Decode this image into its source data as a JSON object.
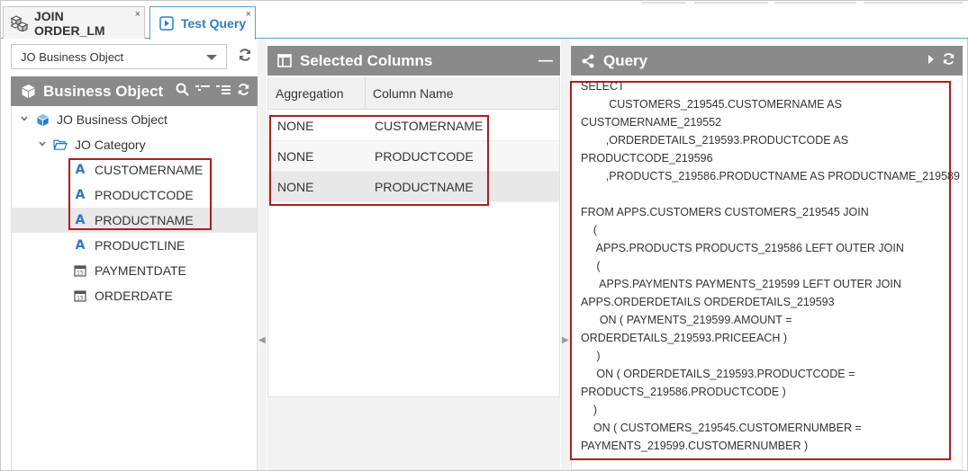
{
  "tabs": [
    {
      "label": "JOIN ORDER_LM",
      "close": "×"
    },
    {
      "label": "Test Query",
      "close": "×"
    }
  ],
  "left": {
    "combo_value": "JO Business Object",
    "panel_title": "Business Object",
    "tree": {
      "root": "JO Business Object",
      "category": "JO Category",
      "items": [
        {
          "label": "CUSTOMERNAME",
          "type": "text"
        },
        {
          "label": "PRODUCTCODE",
          "type": "text"
        },
        {
          "label": "PRODUCTNAME",
          "type": "text"
        },
        {
          "label": "PRODUCTLINE",
          "type": "text"
        },
        {
          "label": "PAYMENTDATE",
          "type": "date"
        },
        {
          "label": "ORDERDATE",
          "type": "date"
        }
      ]
    }
  },
  "middle": {
    "panel_title": "Selected Columns",
    "collapse_symbol": "—",
    "headers": {
      "aggregation": "Aggregation",
      "column_name": "Column Name"
    },
    "rows": [
      {
        "aggregation": "NONE",
        "column": "CUSTOMERNAME"
      },
      {
        "aggregation": "NONE",
        "column": "PRODUCTCODE"
      },
      {
        "aggregation": "NONE",
        "column": "PRODUCTNAME"
      }
    ]
  },
  "right": {
    "panel_title": "Query",
    "lines": [
      "SELECT",
      "         CUSTOMERS_219545.CUSTOMERNAME AS",
      "CUSTOMERNAME_219552",
      "        ,ORDERDETAILS_219593.PRODUCTCODE AS",
      "PRODUCTCODE_219596",
      "        ,PRODUCTS_219586.PRODUCTNAME AS PRODUCTNAME_219589",
      "",
      "FROM APPS.CUSTOMERS CUSTOMERS_219545 JOIN",
      "    (",
      "     APPS.PRODUCTS PRODUCTS_219586 LEFT OUTER JOIN",
      "     (",
      "      APPS.PAYMENTS PAYMENTS_219599 LEFT OUTER JOIN",
      "APPS.ORDERDETAILS ORDERDETAILS_219593",
      "      ON ( PAYMENTS_219599.AMOUNT =",
      "ORDERDETAILS_219593.PRICEEACH )",
      "     )",
      "     ON ( ORDERDETAILS_219593.PRODUCTCODE =",
      "PRODUCTS_219586.PRODUCTCODE )",
      "    )",
      "    ON ( CUSTOMERS_219545.CUSTOMERNUMBER =",
      "PAYMENTS_219599.CUSTOMERNUMBER )"
    ]
  }
}
